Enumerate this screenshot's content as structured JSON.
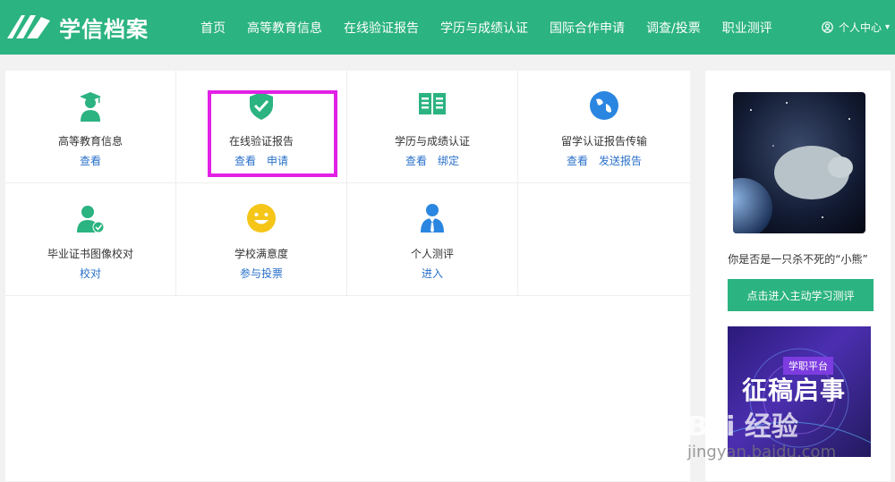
{
  "nav": {
    "logo_text": "学信档案",
    "items": [
      "首页",
      "高等教育信息",
      "在线验证报告",
      "学历与成绩认证",
      "国际合作申请",
      "调查/投票",
      "职业测评"
    ],
    "user_label": "个人中心"
  },
  "services": [
    {
      "title": "高等教育信息",
      "links": [
        "查看"
      ],
      "icon": "graduate-icon"
    },
    {
      "title": "在线验证报告",
      "links": [
        "查看",
        "申请"
      ],
      "icon": "shield-check-icon"
    },
    {
      "title": "学历与成绩认证",
      "links": [
        "查看",
        "绑定"
      ],
      "icon": "certificate-book-icon"
    },
    {
      "title": "留学认证报告传输",
      "links": [
        "查看",
        "发送报告"
      ],
      "icon": "globe-icon"
    },
    {
      "title": "毕业证书图像校对",
      "links": [
        "校对"
      ],
      "icon": "user-check-icon"
    },
    {
      "title": "学校满意度",
      "links": [
        "参与投票"
      ],
      "icon": "smiley-icon"
    },
    {
      "title": "个人测评",
      "links": [
        "进入"
      ],
      "icon": "person-tie-icon"
    }
  ],
  "sidebar": {
    "caption": "你是否是一只杀不死的“小熊”",
    "cta": "点击进入主动学习测评",
    "banner_tag": "学职平台",
    "banner_title": "征稿启事"
  },
  "watermark": {
    "text": "Bai 经验",
    "url": "jingyan.baidu.com"
  },
  "colors": {
    "brand": "#2bb381",
    "link": "#2a70c9",
    "highlight": "#e221e5"
  }
}
